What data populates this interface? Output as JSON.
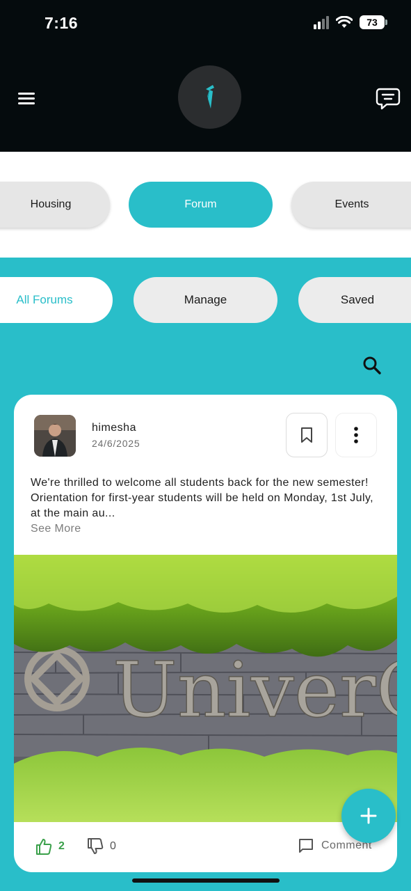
{
  "status_bar": {
    "time": "7:16",
    "battery": "73"
  },
  "header": {
    "menu_icon": "hamburger-menu-icon",
    "logo_icon": "app-logo-icon",
    "chat_icon": "message-icon"
  },
  "main_tabs": [
    {
      "label": "Housing",
      "active": false
    },
    {
      "label": "Forum",
      "active": true
    },
    {
      "label": "Events",
      "active": false
    }
  ],
  "sub_tabs": [
    {
      "label": "All Forums",
      "active": true
    },
    {
      "label": "Manage",
      "active": false
    },
    {
      "label": "Saved",
      "active": false
    }
  ],
  "search_icon": "search-icon",
  "post": {
    "author": "himesha",
    "date": "24/6/2025",
    "text": "We're thrilled to welcome all students back for the new semester! Orientation for first-year students will be held on Monday, 1st July, at the main au...",
    "see_more": "See More",
    "image_sign_text": "UniverCity",
    "likes": "2",
    "dislikes": "0",
    "comment_label": "Comment"
  },
  "colors": {
    "accent": "#29bec9",
    "header_bg": "#050b0d",
    "like_green": "#3aa04a"
  }
}
